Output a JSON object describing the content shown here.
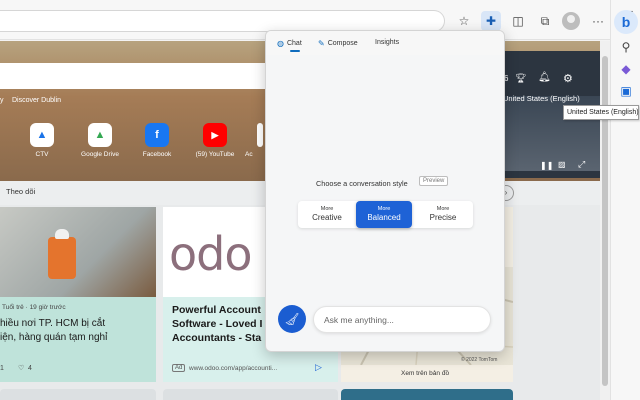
{
  "colors": {
    "accent": "#1e62d6",
    "chat_tab_accent": "#0f6cbd"
  },
  "browser": {
    "toolbar_icons": [
      "star-icon",
      "extensions-icon",
      "split-screen-icon",
      "collections-icon",
      "profile-icon",
      "more-icon"
    ],
    "sidebar_icons": [
      "bing-icon",
      "search-icon",
      "shopping-icon",
      "games-icon",
      "outlook-icon"
    ]
  },
  "tooltip": "United States (English)",
  "page": {
    "hero_location": "Discover Dublin",
    "hero_letter": "y",
    "quick_links": [
      {
        "label": "CTV",
        "icon": "▲"
      },
      {
        "label": "Google Drive",
        "icon": "▲"
      },
      {
        "label": "Facebook",
        "icon": "f"
      },
      {
        "label": "(59) YouTube",
        "icon": "▶"
      },
      {
        "label": "Ac",
        "icon": ""
      }
    ],
    "region": "United States (English)",
    "weather_temp": "6",
    "follow_label": "Theo dõi",
    "card1": {
      "source": "Tuổi trẻ · 19 giờ trước",
      "title_line1": "hiều nơi TP. HCM bị cắt",
      "title_line2": "iện, hàng quán tạm nghỉ",
      "likes": "1",
      "comments": "4"
    },
    "card2": {
      "logo": "odo",
      "title_line1": "Powerful Account",
      "title_line2": "Software - Loved I",
      "title_line3": "Accountants - Sta",
      "ad_badge": "Ad",
      "url": "www.odoo.com/app/accounti..."
    },
    "card3": {
      "copyright": "© 2022 TomTom",
      "map_link": "Xem trên bản đồ"
    }
  },
  "chat_panel": {
    "tabs": [
      {
        "label": "Chat",
        "icon": "chat-icon"
      },
      {
        "label": "Compose",
        "icon": "compose-icon"
      },
      {
        "label": "Insights",
        "icon": ""
      }
    ],
    "style_prompt": "Choose a conversation style",
    "preview_badge": "Preview",
    "styles": [
      {
        "small": "More",
        "big": "Creative",
        "selected": false
      },
      {
        "small": "More",
        "big": "Balanced",
        "selected": true
      },
      {
        "small": "More",
        "big": "Precise",
        "selected": false
      }
    ],
    "input_placeholder": "Ask me anything..."
  }
}
